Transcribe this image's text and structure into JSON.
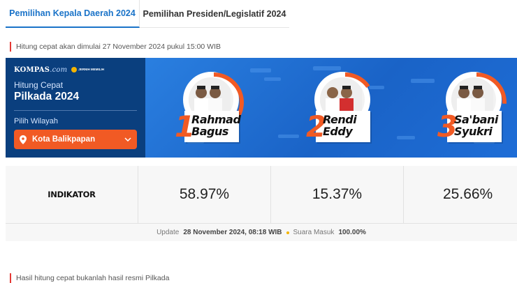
{
  "tabs": [
    {
      "label": "Pemilihan Kepala Daerah 2024",
      "active": true
    },
    {
      "label": "Pemilihan Presiden/Legislatif 2024",
      "active": false
    }
  ],
  "notice_top": "Hitung cepat akan dimulai 27 November 2024 pukul 15:00 WIB",
  "banner": {
    "logo": {
      "kompas": "KOMPAS",
      "com": ".com",
      "partner": "JERNIH MEMILIH"
    },
    "label": "Hitung Cepat",
    "title": "Pilkada 2024",
    "wilayah_label": "Pilih Wilayah",
    "wilayah_value": "Kota Balikpapan",
    "candidates": [
      {
        "number": "1",
        "name_line1": "Rahmad",
        "name_line2": "Bagus",
        "share": 0.5897
      },
      {
        "number": "2",
        "name_line1": "Rendi",
        "name_line2": "Eddy",
        "share": 0.1537
      },
      {
        "number": "3",
        "name_line1": "Sa'bani",
        "name_line2": "Syukri",
        "share": 0.2566
      }
    ]
  },
  "results": {
    "source": "INDIKATOR",
    "percentages": [
      "58.97%",
      "15.37%",
      "25.66%"
    ],
    "update_label": "Update",
    "update_time": "28 November 2024, 08:18 WIB",
    "suara_label": "Suara Masuk",
    "suara_value": "100.00%"
  },
  "notice_bottom": "Hasil hitung cepat bukanlah hasil resmi Pilkada",
  "colors": {
    "accent_blue": "#1a73c8",
    "orange": "#f15a24",
    "navy": "#0a3f7e",
    "red_bar": "#e53935"
  },
  "icons": [
    "location-pin-icon",
    "chevron-down-icon"
  ]
}
